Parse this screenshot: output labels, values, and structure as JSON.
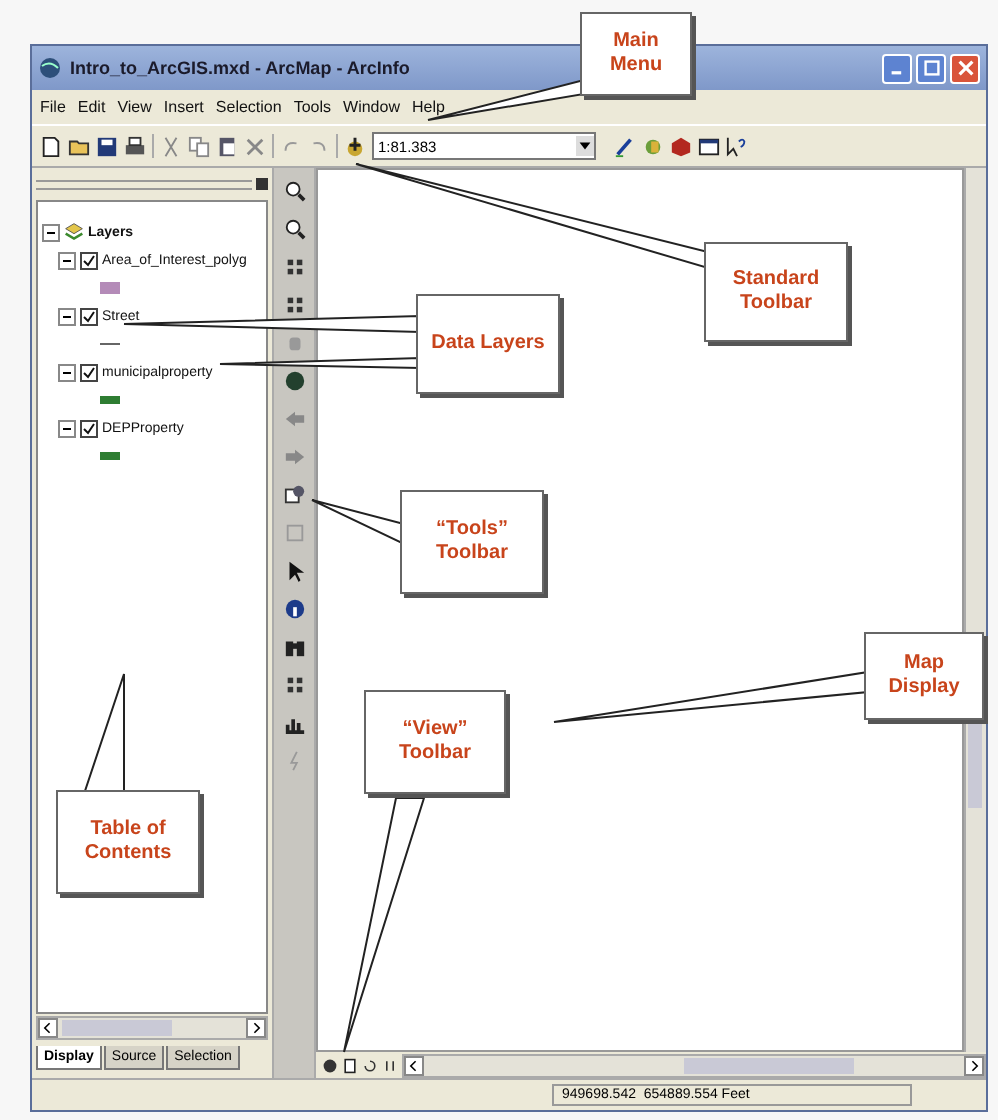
{
  "window": {
    "title": "Intro_to_ArcGIS.mxd - ArcMap - ArcInfo"
  },
  "menu": [
    "File",
    "Edit",
    "View",
    "Insert",
    "Selection",
    "Tools",
    "Window",
    "Help"
  ],
  "standard_toolbar": {
    "scale": "1:81.383"
  },
  "table_of_contents": {
    "label": "Layers",
    "expanded": true,
    "children": [
      {
        "label": "Area_of_Interest_polyg",
        "expanded": true,
        "checked": true,
        "kind": "polygon"
      },
      {
        "label": "Street",
        "expanded": true,
        "checked": true,
        "kind": "line"
      },
      {
        "label": "municipalproperty",
        "expanded": true,
        "checked": true,
        "kind": "point"
      },
      {
        "label": "DEPProperty",
        "expanded": true,
        "checked": true,
        "kind": "point"
      }
    ]
  },
  "toc_tabs": [
    {
      "label": "Display",
      "selected": true
    },
    {
      "label": "Source",
      "selected": false
    },
    {
      "label": "Selection",
      "selected": false
    }
  ],
  "status_bar": {
    "coordinates": "949698.542  654889.554 Feet"
  },
  "callouts": [
    {
      "text": "Main\nMenu"
    },
    {
      "text": "Standard\nToolbar"
    },
    {
      "text": "Data Layers"
    },
    {
      "text": "“Tools”\nToolbar"
    },
    {
      "text": "Map\nDisplay"
    },
    {
      "text": "“View”\nToolbar"
    },
    {
      "text": "Table of\nContents"
    }
  ]
}
